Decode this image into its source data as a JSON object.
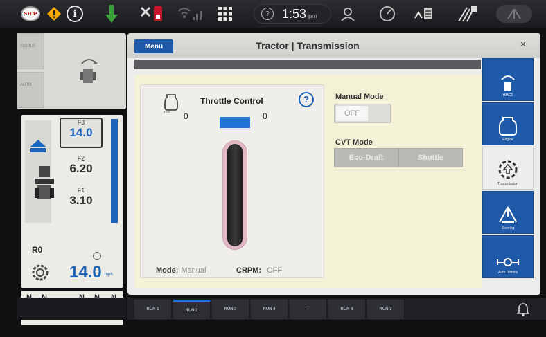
{
  "status_bar": {
    "stop_icon_label": "STOP",
    "info_label": "i",
    "time": "1:53",
    "time_suffix": "pm"
  },
  "left_panel": {
    "isobus_label": "ISOBUS",
    "auto_label": "AUTO",
    "reverse_gear": "R0",
    "gears": [
      {
        "name": "F3",
        "value": "14.0"
      },
      {
        "name": "F2",
        "value": "6.20"
      },
      {
        "name": "F1",
        "value": "3.10"
      }
    ],
    "speed": "14.0",
    "speed_unit": "mph",
    "neutral_labels": [
      "N",
      "N",
      "N",
      "N",
      "N"
    ]
  },
  "window": {
    "menu_label": "Menu",
    "title": "Tractor | Transmission",
    "close_symbol": "×"
  },
  "throttle": {
    "rpm_label": "rpm",
    "title": "Throttle Control",
    "help_symbol": "?",
    "left_value": "0",
    "right_value": "0",
    "mode_label": "Mode:",
    "mode_value": "Manual",
    "crpm_label": "CRPM:",
    "crpm_value": "OFF"
  },
  "manual_mode": {
    "title": "Manual Mode",
    "toggle_value": "OFF"
  },
  "cvt_mode": {
    "title": "CVT Mode",
    "options": [
      "Eco-Draft",
      "Shuttle"
    ]
  },
  "right_tabs": [
    {
      "label": "HMC2",
      "icon": "hitch-icon"
    },
    {
      "label": "Engine",
      "icon": "engine-icon"
    },
    {
      "label": "Transmission",
      "icon": "transmission-icon"
    },
    {
      "label": "Steering",
      "icon": "steering-icon"
    },
    {
      "label": "Auto Difflock",
      "icon": "difflock-icon"
    }
  ],
  "run_bar": {
    "runs": [
      "RUN 1",
      "RUN 2",
      "RUN 3",
      "RUN 4",
      "—",
      "RUN 6",
      "RUN 7"
    ],
    "active_index": 1
  },
  "colors": {
    "accent_blue": "#1e5aa8",
    "throttle_blue": "#1f73d6",
    "content_bg": "#f3f2d7"
  }
}
